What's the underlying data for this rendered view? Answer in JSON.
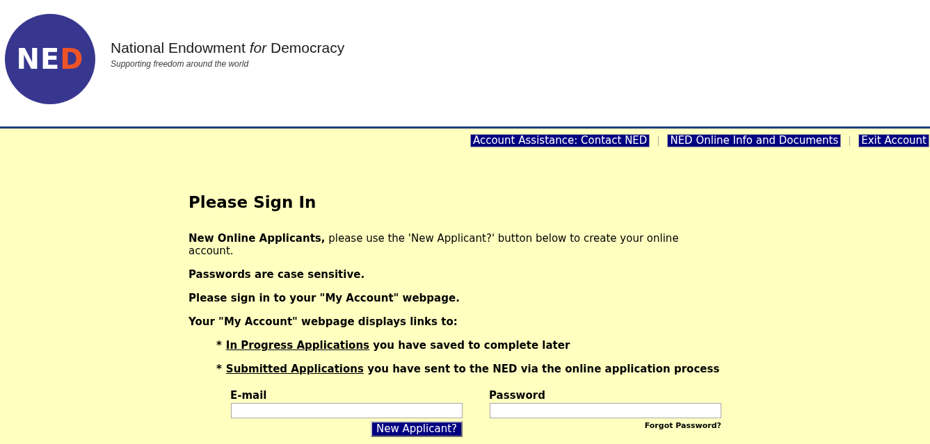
{
  "header": {
    "logo": "NED",
    "org_name": "National Endowment *for* Democracy",
    "tagline": "Supporting freedom around the world"
  },
  "nav_links": [
    "Account Assistance: Contact NED",
    "NED Online Info and Documents",
    "Exit Account"
  ],
  "content": {
    "title": "Please Sign In",
    "intro": "**New Online Applicants,** please use the 'New Applicant?' button below to create your online account.",
    "notes": [
      "Passwords are case sensitive.",
      "Please sign in to your \"My Account\" webpage.",
      "Your \"My Account\" webpage displays links to:"
    ],
    "link_list": [
      {
        "bullet": "*",
        "link": "In Progress Applications",
        "text": "you have saved to complete later"
      },
      {
        "bullet": "*",
        "link": "Submitted Applications",
        "text": "you have sent to the NED via the online application process"
      }
    ]
  },
  "form": {
    "email": {
      "label": "E-mail"
    },
    "password": {
      "label": "Password"
    },
    "new_applicant_button": "New Applicant?",
    "forgot_password": "Forgot Password?"
  }
}
